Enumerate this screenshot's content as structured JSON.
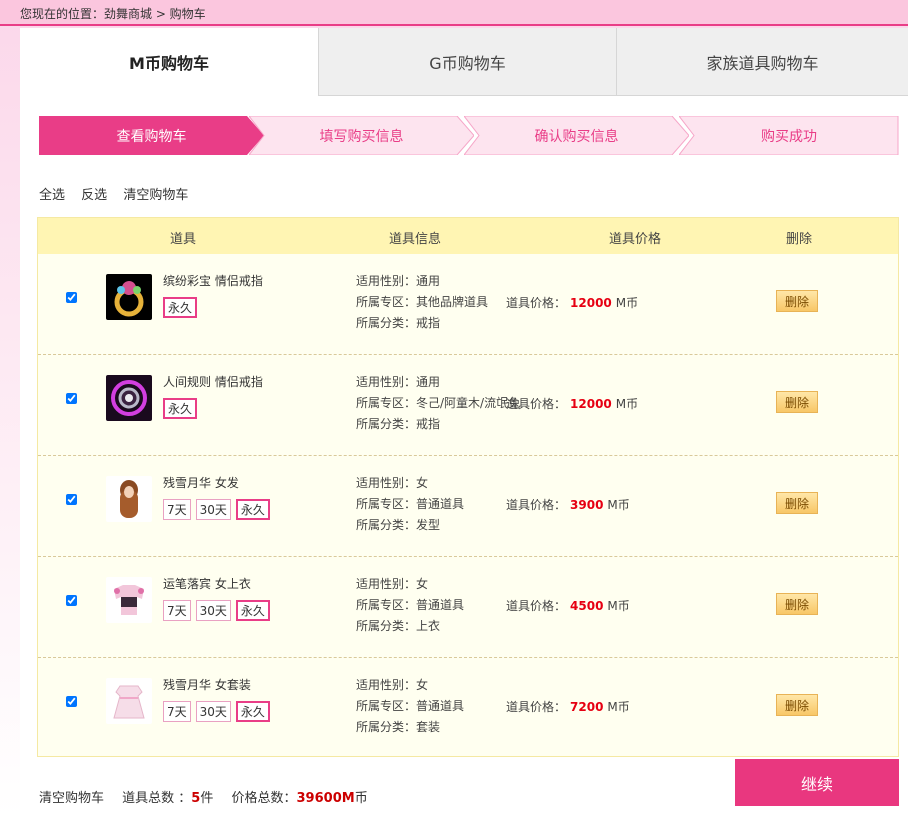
{
  "breadcrumb": "您现在的位置：劲舞商城 > 购物车",
  "tabs": [
    {
      "label": "M币购物车"
    },
    {
      "label": "G币购物车"
    },
    {
      "label": "家族道具购物车"
    }
  ],
  "steps": [
    {
      "label": "查看购物车"
    },
    {
      "label": "填写购买信息"
    },
    {
      "label": "确认购买信息"
    },
    {
      "label": "购买成功"
    }
  ],
  "actions": {
    "select_all": "全选",
    "invert": "反选",
    "clear": "清空购物车"
  },
  "headers": {
    "item": "道具",
    "info": "道具信息",
    "price": "道具价格",
    "delete": "删除"
  },
  "labels": {
    "gender": "适用性别：",
    "zone": "所属专区：",
    "category": "所属分类：",
    "price": "道具价格：",
    "currency": "M币",
    "delete": "删除"
  },
  "items": [
    {
      "name": "缤纷彩宝 情侣戒指",
      "options": [
        "永久"
      ],
      "selected": "永久",
      "gender": "通用",
      "zone": "其他品牌道具",
      "category": "戒指",
      "price": "12000",
      "checked": true
    },
    {
      "name": "人间规则 情侣戒指",
      "options": [
        "永久"
      ],
      "selected": "永久",
      "gender": "通用",
      "zone": "冬己/阿童木/流氓兔",
      "category": "戒指",
      "price": "12000",
      "checked": true
    },
    {
      "name": "残雪月华 女发",
      "options": [
        "7天",
        "30天",
        "永久"
      ],
      "selected": "永久",
      "gender": "女",
      "zone": "普通道具",
      "category": "发型",
      "price": "3900",
      "checked": true
    },
    {
      "name": "运笔落宾 女上衣",
      "options": [
        "7天",
        "30天",
        "永久"
      ],
      "selected": "永久",
      "gender": "女",
      "zone": "普通道具",
      "category": "上衣",
      "price": "4500",
      "checked": true
    },
    {
      "name": "残雪月华 女套装",
      "options": [
        "7天",
        "30天",
        "永久"
      ],
      "selected": "永久",
      "gender": "女",
      "zone": "普通道具",
      "category": "套装",
      "price": "7200",
      "checked": true
    }
  ],
  "footer": {
    "clear": "清空购物车",
    "count_label": "道具总数 ：",
    "count": "5",
    "count_unit": "件",
    "total_label": "价格总数：",
    "total": "39600M",
    "total_unit": "币"
  },
  "continue_label": "继续",
  "colors": {
    "accent": "#e93d87",
    "price": "#e60012"
  }
}
